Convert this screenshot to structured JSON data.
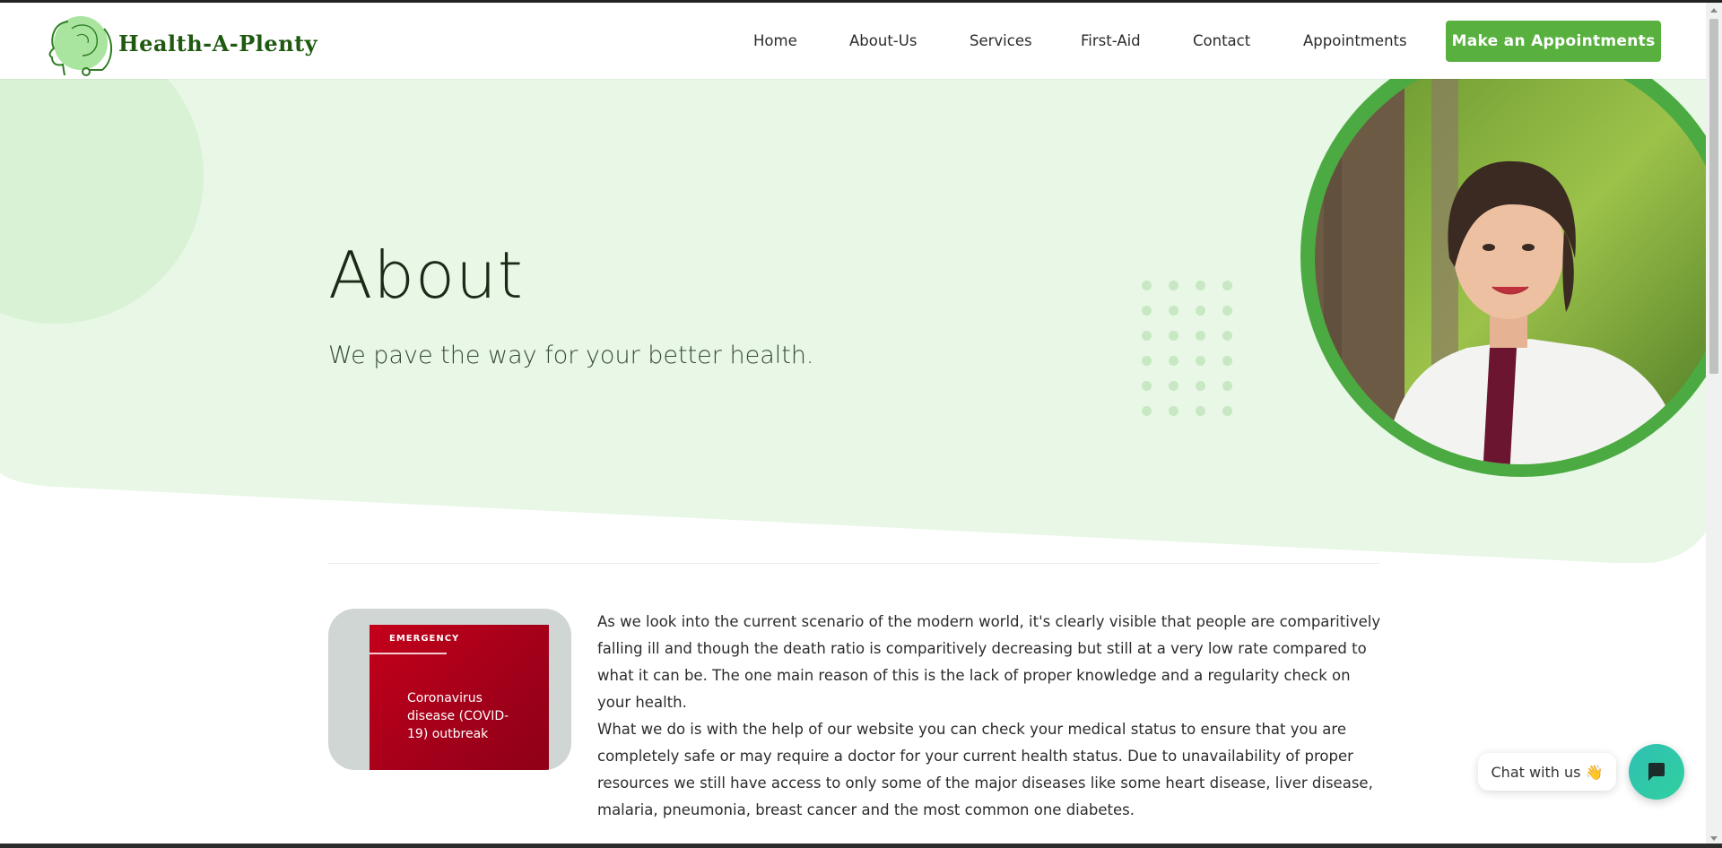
{
  "brand": {
    "name": "Health-A-Plenty"
  },
  "nav": {
    "items": [
      {
        "label": "Home"
      },
      {
        "label": "About-Us"
      },
      {
        "label": "Services"
      },
      {
        "label": "First-Aid"
      },
      {
        "label": "Contact"
      },
      {
        "label": "Appointments"
      }
    ],
    "cta_label": "Make an Appointments"
  },
  "hero": {
    "title": "About",
    "subtitle": "We pave the way for your better health."
  },
  "thumbnail": {
    "sign_header": "EMERGENCY",
    "sign_text": "Coronavirus disease (COVID-19) outbreak"
  },
  "content": {
    "paragraphs": [
      "As we look into the current scenario of the modern world, it's clearly visible that people are comparitively falling ill and though the death ratio is comparitively decreasing but still at a very low rate compared to what it can be. The one main reason of this is the lack of proper knowledge and a regularity check on your health.",
      "What we do is with the help of our website you can check your medical status to ensure that you are completely safe or may require a doctor for your current health status. Due to unavailability of proper resources we still have access to only some of the major diseases like some heart disease, liver disease, malaria, pneumonia, breast cancer and the most common one diabetes."
    ]
  },
  "chat": {
    "label": "Chat with us 👋"
  },
  "colors": {
    "accent_green": "#58b03f",
    "hero_background": "#e8f7e6",
    "logo_green": "#1f5a10",
    "chat_teal": "#2fc0b3"
  },
  "icons": {
    "logo": "head-stethoscope-icon",
    "chat": "chat-bubble-icon"
  }
}
